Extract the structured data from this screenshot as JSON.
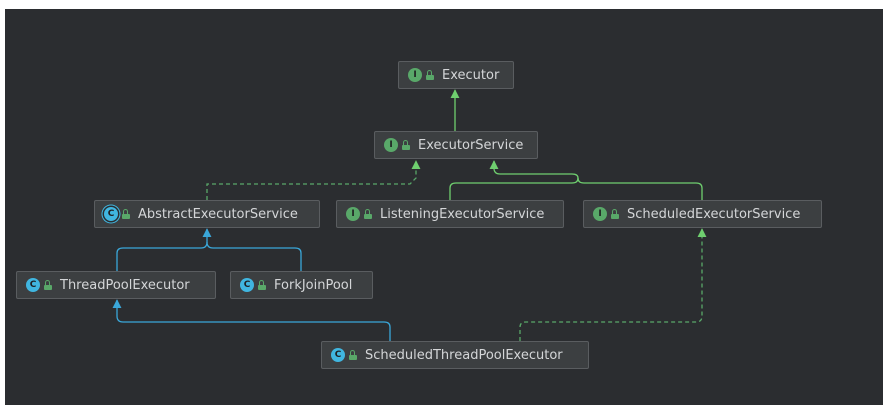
{
  "diagram": {
    "nodes": {
      "executor": {
        "name": "Executor",
        "kind": "interface",
        "badge": "I"
      },
      "executor_service": {
        "name": "ExecutorService",
        "kind": "interface",
        "badge": "I"
      },
      "abstract_executor_service": {
        "name": "AbstractExecutorService",
        "kind": "abstract",
        "badge": "C"
      },
      "listening_executor_service": {
        "name": "ListeningExecutorService",
        "kind": "interface",
        "badge": "I"
      },
      "scheduled_executor_service": {
        "name": "ScheduledExecutorService",
        "kind": "interface",
        "badge": "I"
      },
      "thread_pool_executor": {
        "name": "ThreadPoolExecutor",
        "kind": "class",
        "badge": "C"
      },
      "fork_join_pool": {
        "name": "ForkJoinPool",
        "kind": "class",
        "badge": "C"
      },
      "scheduled_thread_pool_executor": {
        "name": "ScheduledThreadPoolExecutor",
        "kind": "class",
        "badge": "C"
      }
    },
    "relations": [
      {
        "from": "ExecutorService",
        "to": "Executor",
        "type": "extends"
      },
      {
        "from": "AbstractExecutorService",
        "to": "ExecutorService",
        "type": "implements"
      },
      {
        "from": "ListeningExecutorService",
        "to": "ExecutorService",
        "type": "extends"
      },
      {
        "from": "ScheduledExecutorService",
        "to": "ExecutorService",
        "type": "extends"
      },
      {
        "from": "ThreadPoolExecutor",
        "to": "AbstractExecutorService",
        "type": "extends"
      },
      {
        "from": "ForkJoinPool",
        "to": "AbstractExecutorService",
        "type": "extends"
      },
      {
        "from": "ScheduledThreadPoolExecutor",
        "to": "ThreadPoolExecutor",
        "type": "extends"
      },
      {
        "from": "ScheduledThreadPoolExecutor",
        "to": "ScheduledExecutorService",
        "type": "implements"
      }
    ],
    "colors": {
      "background": "#2b2d30",
      "node_fill": "#3c3f41",
      "interface_extends_edge": "#6fcf6f",
      "implements_edge": "#59a869",
      "class_extends_edge": "#3aa7d9",
      "interface_badge": "#59a869",
      "class_badge": "#40b6e0"
    }
  }
}
